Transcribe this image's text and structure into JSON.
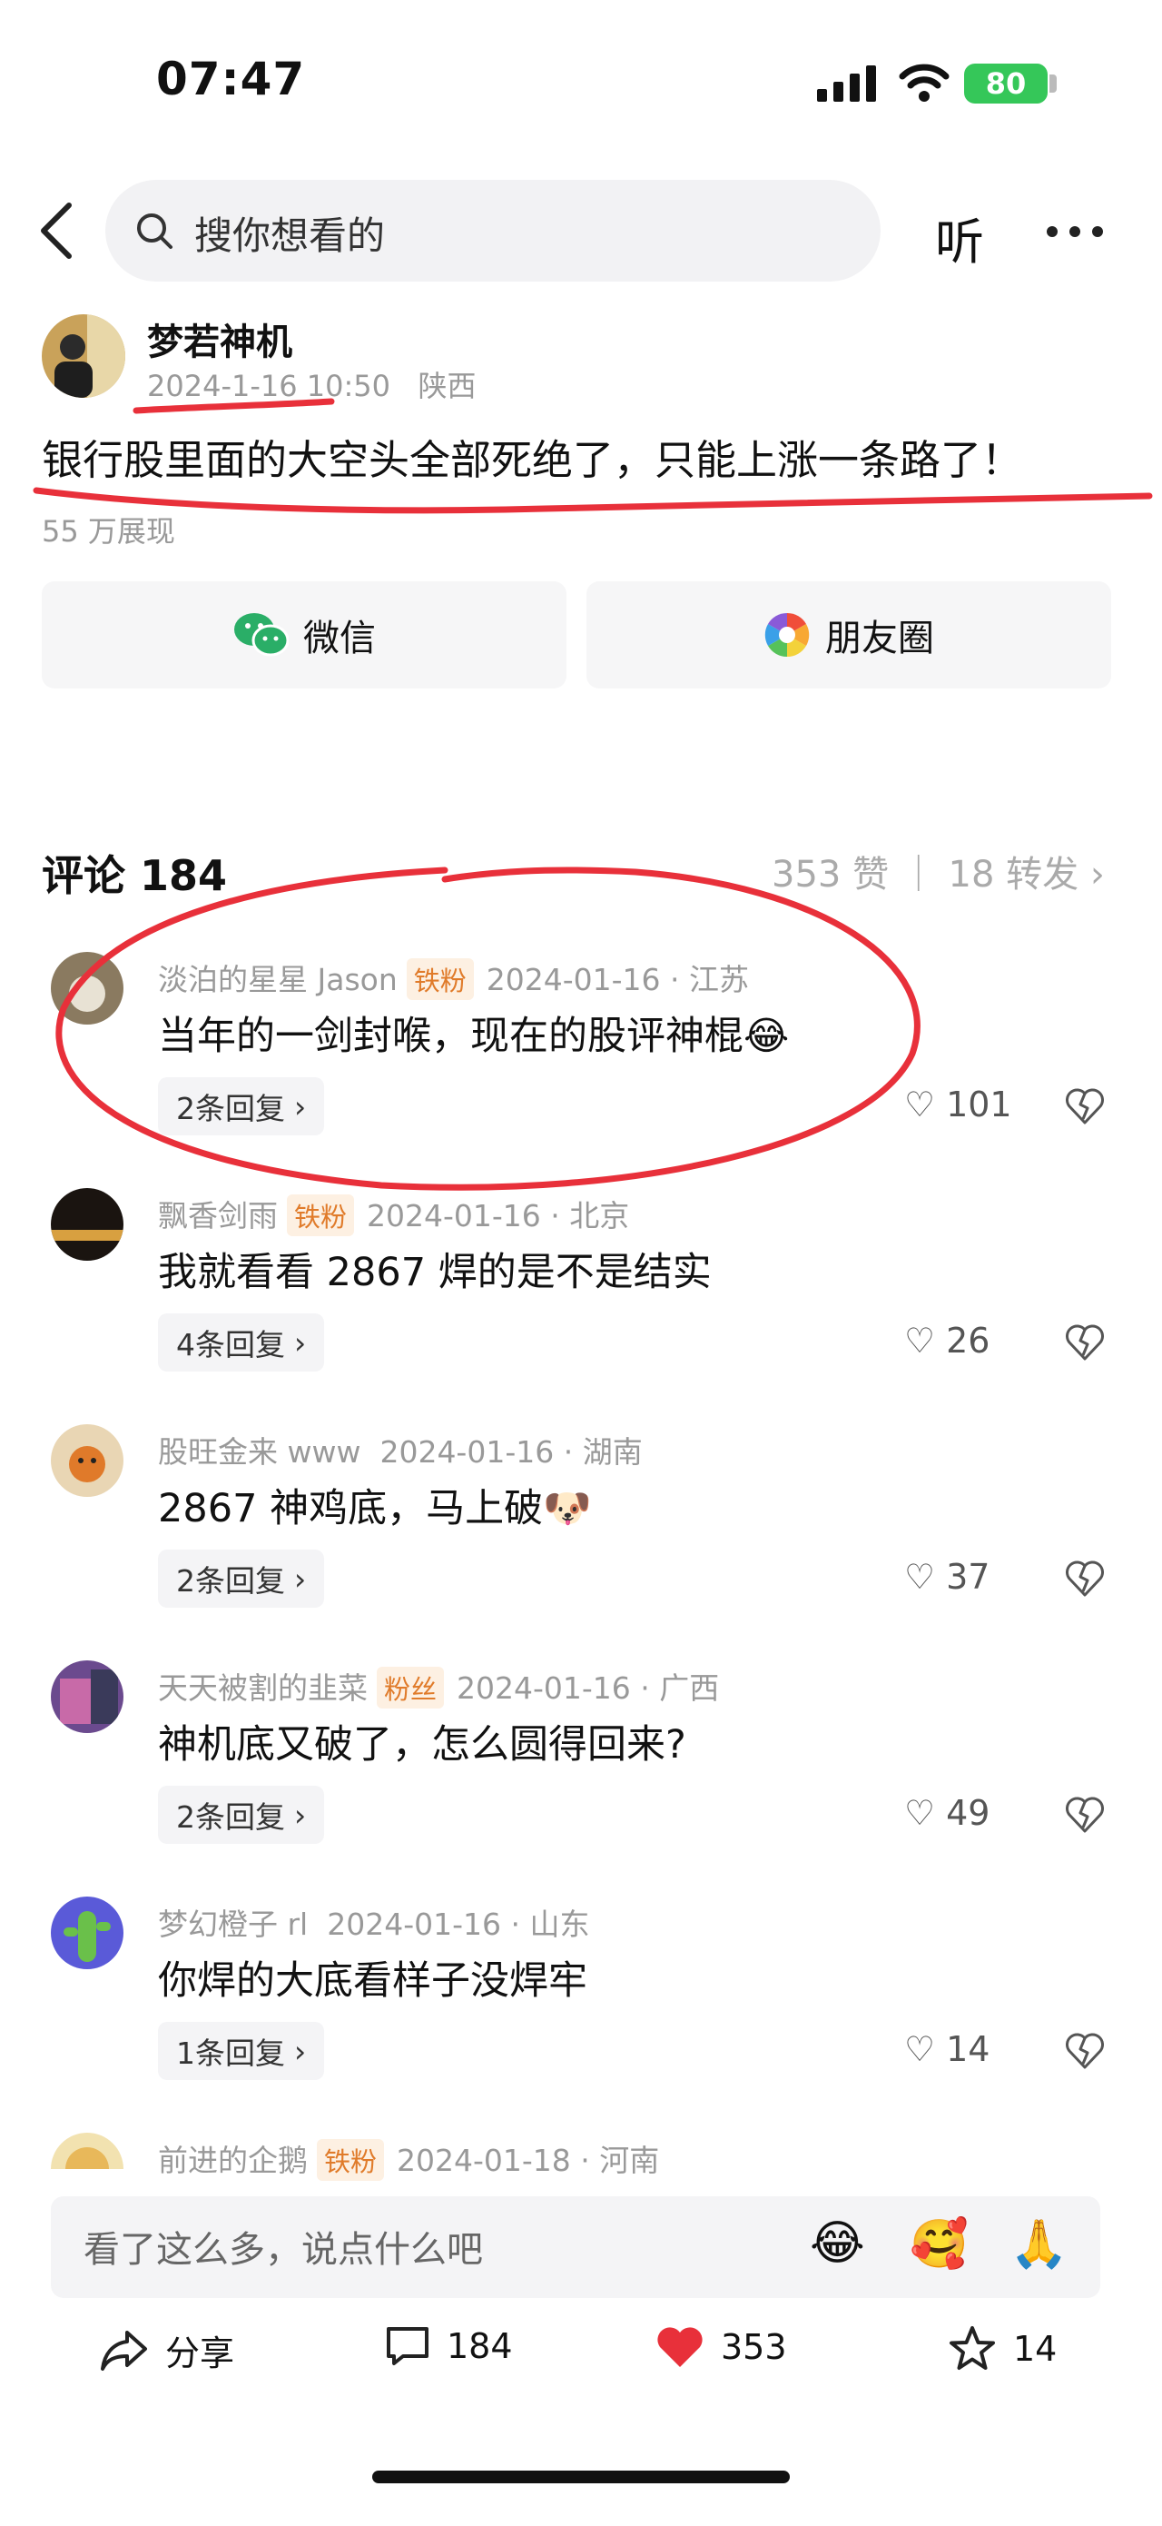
{
  "status_bar": {
    "time": "07:47",
    "battery": "80"
  },
  "nav": {
    "search_placeholder": "搜你想看的",
    "listen_label": "听"
  },
  "post": {
    "author": "梦若神机",
    "date": "2024-1-16 10:50",
    "location": "陕西",
    "text": "银行股里面的大空头全部死绝了，只能上涨一条路了！",
    "views": "55 万展现",
    "share_wechat": "微信",
    "share_moments": "朋友圈"
  },
  "comments_header": {
    "title": "评论 184",
    "stats": "353 赞 ｜ 18 转发"
  },
  "comments": [
    {
      "user": "淡泊的星星 Jason",
      "badge": "铁粉",
      "meta": "2024-01-16 · 江苏",
      "text": "当年的一剑封喉，现在的股评神棍😂",
      "replies": "2条回复",
      "likes": "101"
    },
    {
      "user": "飘香剑雨",
      "badge": "铁粉",
      "meta": "2024-01-16 · 北京",
      "text": "我就看看 2867 焊的是不是结实",
      "replies": "4条回复",
      "likes": "26"
    },
    {
      "user": "股旺金来 www",
      "badge": "",
      "meta": "2024-01-16 · 湖南",
      "text": "2867 神鸡底，马上破🐶",
      "replies": "2条回复",
      "likes": "37"
    },
    {
      "user": "天天被割的韭菜",
      "badge": "粉丝",
      "meta": "2024-01-16 · 广西",
      "text": "神机底又破了，怎么圆得回来?",
      "replies": "2条回复",
      "likes": "49"
    },
    {
      "user": "梦幻橙子 rl",
      "badge": "",
      "meta": "2024-01-16 · 山东",
      "text": "你焊的大底看样子没焊牢",
      "replies": "1条回复",
      "likes": "14"
    },
    {
      "user": "前进的企鹅",
      "badge": "铁粉",
      "meta": "2024-01-18 · 河南",
      "text": "",
      "replies": "",
      "likes": ""
    }
  ],
  "input": {
    "placeholder": "看了这么多，说点什么吧",
    "emoji1": "😂",
    "emoji2": "🥰",
    "emoji3": "🙏"
  },
  "bottom": {
    "share": "分享",
    "comments": "184",
    "likes": "353",
    "favorites": "14"
  },
  "colors": {
    "accent_red": "#e8303a",
    "wechat_green": "#2aae67",
    "battery_green": "#35c759"
  }
}
